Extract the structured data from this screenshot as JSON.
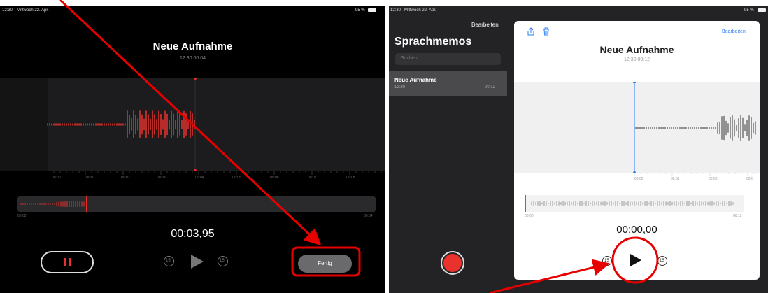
{
  "left": {
    "status_time": "12:30",
    "status_date": "Mittwoch 22. Apr.",
    "status_battery": "95 %",
    "title": "Neue Aufnahme",
    "subtitle_time": "12:30",
    "subtitle_duration": "00:04",
    "timeline_ticks": [
      "00:00",
      "00:01",
      "00:02",
      "00:03",
      "00:04",
      "00:05",
      "00:06",
      "00:07",
      "00:08"
    ],
    "overview_start": "00:02",
    "overview_end": "00:04",
    "timer": "00:03,95",
    "skip_back_label": "15",
    "skip_forward_label": "15",
    "done_button": "Fertig"
  },
  "right": {
    "status_time": "12:30",
    "status_date": "Mittwoch 22. Apr.",
    "status_battery": "95 %",
    "sidebar_edit": "Bearbeiten",
    "sidebar_title": "Sprachmemos",
    "search_placeholder": "Suchen",
    "recording_item": {
      "title": "Neue Aufnahme",
      "time": "12:30",
      "duration": "00:12"
    },
    "card_edit": "Bearbeiten",
    "card_title": "Neue Aufnahme",
    "card_subtitle_time": "12:30",
    "card_subtitle_duration": "00:12",
    "card_ticks": [
      "00:00",
      "00:01",
      "00:02",
      "00:0"
    ],
    "overview_start": "00:00",
    "overview_end": "00:12",
    "timer": "00:00,00",
    "skip_back_label": "15",
    "skip_forward_label": "15"
  },
  "colors": {
    "accent_red": "#e8322b",
    "annotation_red": "#e60000",
    "ios_blue": "#2d7cf6"
  },
  "icons": [
    "pause-icon",
    "play-icon",
    "skip-back-15-icon",
    "skip-forward-15-icon",
    "share-icon",
    "trash-icon",
    "record-icon"
  ]
}
